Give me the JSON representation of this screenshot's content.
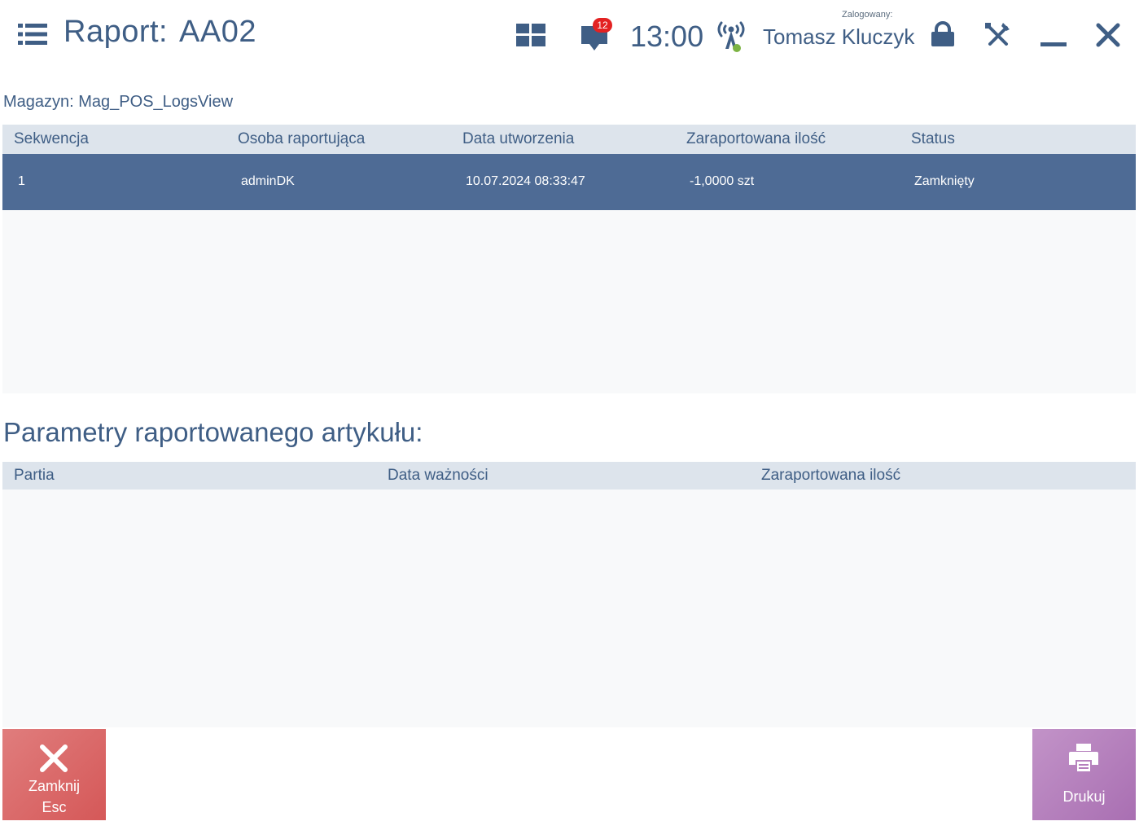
{
  "header": {
    "title_label": "Raport:",
    "title_code": "AA02",
    "notification_count": "12",
    "clock": "13:00",
    "login_label": "Zalogowany:",
    "user_name": "Tomasz Kluczyk"
  },
  "warehouse": "Magazyn: Mag_POS_LogsView",
  "report_table": {
    "columns": [
      "Sekwencja",
      "Osoba raportująca",
      "Data utworzenia",
      "Zaraportowana ilość",
      "Status"
    ],
    "rows": [
      {
        "sequence": "1",
        "person": "adminDK",
        "created": "10.07.2024 08:33:47",
        "quantity": "-1,0000 szt",
        "status": "Zamknięty"
      }
    ]
  },
  "params_section": {
    "title": "Parametry raportowanego artykułu:",
    "columns": [
      "Partia",
      "Data ważności",
      "Zaraportowana ilość"
    ]
  },
  "buttons": {
    "close_label": "Zamknij",
    "close_key": "Esc",
    "print_label": "Drukuj"
  },
  "icons": {
    "menu": "menu-list-icon",
    "tiles": "tiles-icon",
    "messages": "message-icon",
    "signal": "signal-icon",
    "lock": "lock-icon",
    "tools": "tools-icon",
    "minimize": "minimize-icon",
    "close": "close-icon",
    "print": "printer-icon"
  },
  "colors": {
    "accent": "#3f5e85",
    "selected_row": "#4e6b95",
    "header_row": "#dde4ec",
    "badge": "#e32222",
    "close_button": "#d96767",
    "print_button": "#b57fbd",
    "signal_dot": "#7cb342"
  }
}
